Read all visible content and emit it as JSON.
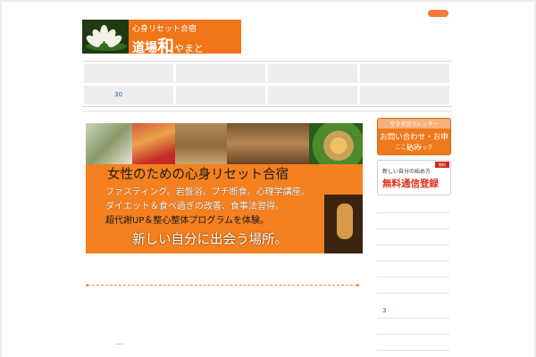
{
  "header": {
    "logo_subtitle": "心身リセット合宿",
    "logo_title_a": "道場",
    "logo_title_big": "和",
    "logo_title_b": "やまと"
  },
  "nav": {
    "number_label": "30"
  },
  "banner": {
    "headline": "女性のための心身リセット合宿",
    "line1": "ファスティング。岩盤浴。プチ断食。心理学講座。",
    "line2": "ダイエット＆食べ過ぎの改善、食事法習得。",
    "line3": "超代謝UP＆整心整体プログラムを体験。",
    "tagline": "新しい自分に出会う場所。"
  },
  "main": {
    "ellipsis": "…"
  },
  "sidebar": {
    "contact_button": {
      "top_label": "空き状況カレンダー",
      "main_label": "お問い合わせ・お申込み",
      "sub_label": "ここをクリック"
    },
    "register_button": {
      "top_label": "新しい自分の始め方",
      "main_label": "無料通信登録",
      "badge": "無料"
    },
    "number_label": "3"
  },
  "colors": {
    "accent": "#f07418",
    "link": "#3a56a8",
    "register_red": "#e0301e"
  }
}
